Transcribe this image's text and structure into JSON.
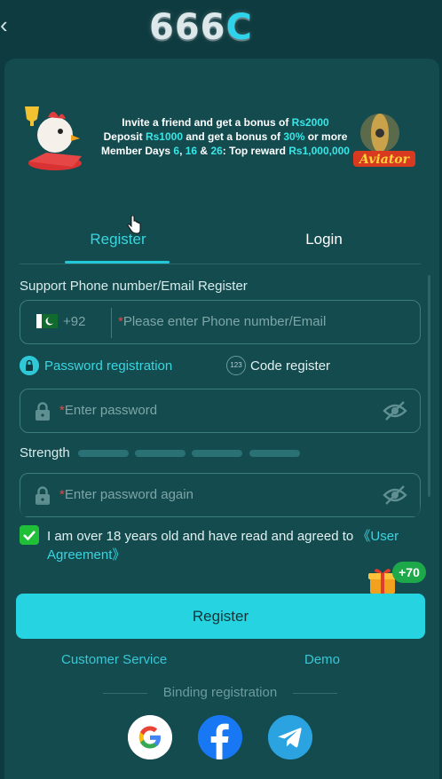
{
  "header": {
    "back_glyph": "‹",
    "logo_text": "666",
    "logo_c": "C"
  },
  "banner": {
    "line1": {
      "pre": "Invite a friend and get a bonus of ",
      "hl": "Rs2000"
    },
    "line2": {
      "a": "Deposit ",
      "b": "Rs1000",
      "c": " and get a bonus of ",
      "d": "30%",
      "e": " or more"
    },
    "line3": {
      "a": "Member Days ",
      "b": "6",
      "c": ", ",
      "d": "16",
      "e": " & ",
      "f": "26",
      "g": ": Top reward ",
      "h": "Rs1,000,000"
    },
    "aviator_label": "Aviator"
  },
  "tabs": [
    {
      "label": "Register",
      "active": true
    },
    {
      "label": "Login",
      "active": false
    }
  ],
  "form": {
    "support_label": "Support Phone number/Email Register",
    "country_code": "+92",
    "phone_placeholder": "Please enter Phone number/Email",
    "option_password": "Password registration",
    "option_code": "Code register",
    "option_code_badge": "123",
    "password_placeholder": "Enter password",
    "password_again_placeholder": "Enter password again",
    "strength_label": "Strength",
    "strength_level": 0,
    "agree_text": "I am over 18 years old and have read and agreed to ",
    "agree_link": "《User Agreement》",
    "agree_checked": true,
    "bonus_badge": "+70",
    "register_button": "Register"
  },
  "links": {
    "customer_service": "Customer Service",
    "demo": "Demo"
  },
  "binding": {
    "label": "Binding registration",
    "providers": [
      "google",
      "facebook",
      "telegram"
    ]
  },
  "colors": {
    "background": "#0e3b3f",
    "card": "#134b4f",
    "accent": "#26d3e0",
    "check": "#1fbf37",
    "required_star": "#e8484a"
  }
}
